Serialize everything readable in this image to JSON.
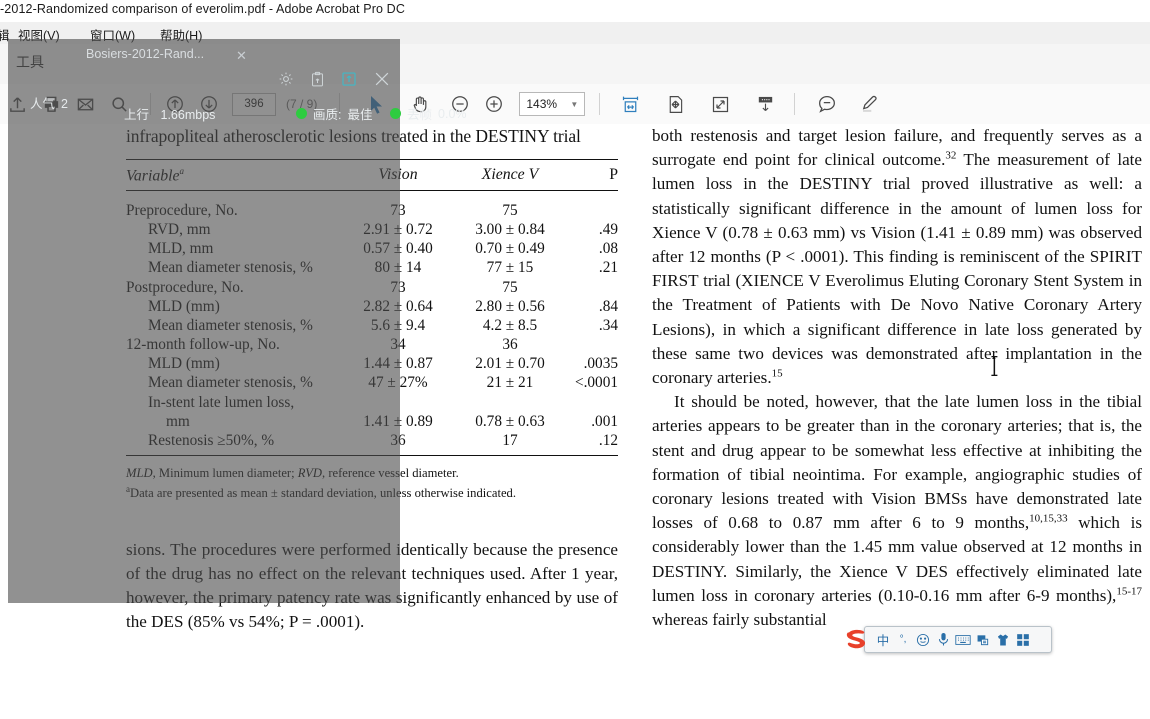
{
  "window": {
    "title": "-2012-Randomized comparison of everolim.pdf - Adobe Acrobat Pro DC",
    "menu": [
      "辑",
      "视图(V)",
      "窗口(W)",
      "帮助(H)"
    ],
    "tools_label": "工具"
  },
  "toolbar": {
    "icons": [
      {
        "name": "upload-file-icon",
        "label": "上传"
      },
      {
        "name": "print-icon",
        "label": "打印"
      },
      {
        "name": "email-icon",
        "label": "电子邮件"
      },
      {
        "name": "search-icon",
        "label": "搜索"
      },
      {
        "name": "previous-page-icon",
        "label": "上一页"
      },
      {
        "name": "next-page-icon",
        "label": "下一页"
      }
    ],
    "page_number": "396",
    "page_count": "(7 / 9)",
    "select-tool": "选择工具",
    "hand-tool": "手形工具",
    "zoom_out": "缩小",
    "zoom_in": "放大",
    "zoom_level": "143%",
    "right_icons": [
      {
        "name": "fit-width-icon",
        "label": "适合宽度"
      },
      {
        "name": "fit-page-icon",
        "label": "适合页面"
      },
      {
        "name": "fullscreen-icon",
        "label": "全屏"
      },
      {
        "name": "scroll-mode-icon",
        "label": "滚动模式"
      },
      {
        "name": "comment-icon",
        "label": "注释"
      },
      {
        "name": "highlight-icon",
        "label": "高亮"
      }
    ]
  },
  "overlay": {
    "tab_title": "Bosiers-2012-Rand...",
    "tab_close": "✕",
    "popularity_label": "人气",
    "popularity_value": "2",
    "uplink_label": "上行",
    "uplink_value": "1.66mbps",
    "quality_label": "画质:",
    "quality_value": "最佳",
    "dropped_label": "丢帧",
    "dropped_value": "0.0%",
    "dot_color": "#2ecc40",
    "icons": [
      {
        "name": "gear-icon",
        "label": "设置"
      },
      {
        "name": "clipboard-upload-icon",
        "label": "剪贴板"
      },
      {
        "name": "share-window-icon",
        "label": "共享窗口"
      },
      {
        "name": "close-icon",
        "label": "关闭"
      }
    ]
  },
  "ime": {
    "logo": "S",
    "buttons": [
      {
        "name": "ime-chinese-mode-icon",
        "glyph": "中"
      },
      {
        "name": "ime-punctuation-icon",
        "glyph": "°,"
      },
      {
        "name": "ime-emoji-icon",
        "glyph": "☺"
      },
      {
        "name": "ime-voice-input-icon",
        "glyph": "🎤"
      },
      {
        "name": "ime-soft-keyboard-icon",
        "glyph": "⌨"
      },
      {
        "name": "ime-screenshot-icon",
        "glyph": "▤"
      },
      {
        "name": "ime-skin-icon",
        "glyph": "👕"
      },
      {
        "name": "ime-toolbox-icon",
        "glyph": "▦"
      }
    ]
  },
  "document": {
    "table": {
      "caption": "infrapopliteal atherosclerotic lesions treated in the DESTINY trial",
      "headers": [
        "Variable",
        "Vision",
        "Xience V",
        "P"
      ],
      "header_sup": "a",
      "rows": [
        {
          "label": "Preprocedure, No.",
          "indent": 0,
          "vision": "73",
          "xience": "75",
          "p": ""
        },
        {
          "label": "RVD, mm",
          "indent": 1,
          "vision": "2.91 ± 0.72",
          "xience": "3.00 ± 0.84",
          "p": ".49"
        },
        {
          "label": "MLD, mm",
          "indent": 1,
          "vision": "0.57 ± 0.40",
          "xience": "0.70 ± 0.49",
          "p": ".08"
        },
        {
          "label": "Mean diameter stenosis, %",
          "indent": 1,
          "vision": "80 ± 14",
          "xience": "77 ± 15",
          "p": ".21"
        },
        {
          "label": "Postprocedure, No.",
          "indent": 0,
          "vision": "73",
          "xience": "75",
          "p": ""
        },
        {
          "label": "MLD (mm)",
          "indent": 1,
          "vision": "2.82 ± 0.64",
          "xience": "2.80 ± 0.56",
          "p": ".84"
        },
        {
          "label": "Mean diameter stenosis, %",
          "indent": 1,
          "vision": "5.6 ± 9.4",
          "xience": "4.2 ± 8.5",
          "p": ".34"
        },
        {
          "label": "12-month follow-up, No.",
          "indent": 0,
          "vision": "34",
          "xience": "36",
          "p": ""
        },
        {
          "label": "MLD (mm)",
          "indent": 1,
          "vision": "1.44 ± 0.87",
          "xience": "2.01 ± 0.70",
          "p": ".0035"
        },
        {
          "label": "Mean diameter stenosis, %",
          "indent": 1,
          "vision": "47 ± 27%",
          "xience": "21 ± 21",
          "p": "<.0001"
        },
        {
          "label": "In-stent late lumen loss,",
          "indent": 1,
          "vision": "",
          "xience": "",
          "p": ""
        },
        {
          "label": "mm",
          "indent": 2,
          "vision": "1.41 ± 0.89",
          "xience": "0.78 ± 0.63",
          "p": ".001"
        },
        {
          "label": "Restenosis ≥50%, %",
          "indent": 1,
          "vision": "36",
          "xience": "17",
          "p": ".12"
        }
      ],
      "footnote_1_abbr_1": "MLD",
      "footnote_1_text_1": ", Minimum lumen diameter; ",
      "footnote_1_abbr_2": "RVD",
      "footnote_1_text_2": ", reference vessel diameter.",
      "footnote_2": "Data are presented as mean ± standard deviation, unless otherwise indicated.",
      "footnote_2_marker": "a"
    },
    "left_paragraph": "sions. The procedures were performed identically because the presence of the drug has no effect on the relevant techniques used. After 1 year, however, the primary patency rate was significantly enhanced by use of the DES (85% vs 54%; P = .0001).",
    "right_paragraph_1_a": "both restenosis and target lesion failure, and frequently serves as a surrogate end point for clinical outcome.",
    "right_paragraph_1_sup": "32",
    "right_paragraph_1_b": " The measurement of late lumen loss in the DESTINY trial proved illustrative as well: a statistically significant difference in the amount of lumen loss for Xience V (0.78 ± 0.63 mm) vs Vision (1.41 ± 0.89 mm) was observed after 12 months (P < .0001). This finding is reminiscent of the SPIRIT FIRST trial (XIENCE V Everolimus Eluting Coronary Stent System in the Treatment of Patients with De Novo Native Coronary Artery Lesions), in which a significant difference in late loss generated by these same two devices was demonstrated after implantation in the coronary arteries.",
    "right_paragraph_1_sup2": "15",
    "right_paragraph_2_a": "It should be noted, however, that the late lumen loss in the tibial arteries appears to be greater than in the coronary arteries; that is, the stent and drug appear to be somewhat less effective at inhibiting the formation of tibial neointima. For example, angiographic studies of coronary lesions treated with Vision BMSs have demonstrated late losses of 0.68 to 0.87 mm after 6 to 9 months,",
    "right_paragraph_2_sup": "10,15,33",
    "right_paragraph_2_b": " which is considerably lower than the 1.45 mm value observed at 12 months in DESTINY. Similarly, the Xience V DES effectively eliminated late lumen loss in coronary arteries (0.10-0.16 mm after 6-9 months),",
    "right_paragraph_2_sup2": "15-17",
    "right_paragraph_2_c": " whereas fairly substantial"
  }
}
